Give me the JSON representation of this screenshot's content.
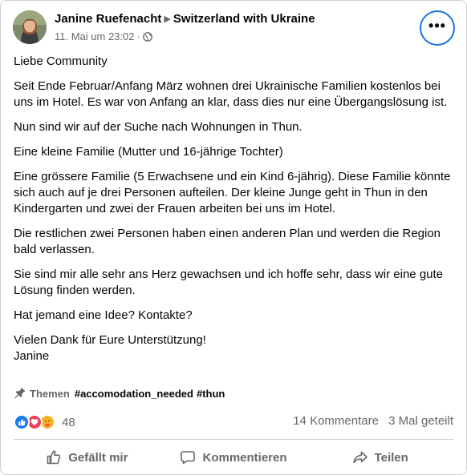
{
  "post": {
    "author": "Janine Ruefenacht",
    "group": "Switzerland with Ukraine",
    "timestamp": "11. Mai um 23:02",
    "privacy_icon": "globe-icon",
    "more_label": "•••",
    "paragraphs": [
      "Liebe Community",
      "Seit Ende Februar/Anfang März wohnen drei Ukrainische Familien kostenlos bei uns im Hotel. Es war von Anfang an klar, dass dies nur eine Übergangslösung ist.",
      "Nun sind wir auf der Suche nach Wohnungen in Thun.",
      "Eine kleine Familie (Mutter und 16-jährige Tochter)",
      "Eine grössere Familie (5 Erwachsene und ein Kind 6-jährig). Diese Familie könnte sich auch auf je drei Personen aufteilen. Der kleine Junge geht in Thun in den Kindergarten und zwei der Frauen arbeiten bei uns im Hotel.",
      "Die restlichen zwei Personen haben einen anderen Plan und werden die Region bald verlassen.",
      "Sie sind mir alle sehr ans Herz gewachsen und ich hoffe sehr, dass wir eine gute Lösung finden werden.",
      "Hat jemand eine Idee? Kontakte?",
      "Vielen Dank für Eure Unterstützung!\nJanine"
    ]
  },
  "topics": {
    "label": "Themen",
    "tags": [
      "#accomodation_needed",
      "#thun"
    ]
  },
  "reactions": {
    "icons": [
      "like-reaction-icon",
      "love-reaction-icon",
      "care-reaction-icon"
    ],
    "count": "48"
  },
  "counts": {
    "comments": "14 Kommentare",
    "shares": "3 Mal geteilt"
  },
  "actions": {
    "like": "Gefällt mir",
    "comment": "Kommentieren",
    "share": "Teilen"
  },
  "colors": {
    "accent": "#1b74e4",
    "secondary_text": "#65676b",
    "like_blue": "#1877f2",
    "love_red": "#f33e58"
  }
}
